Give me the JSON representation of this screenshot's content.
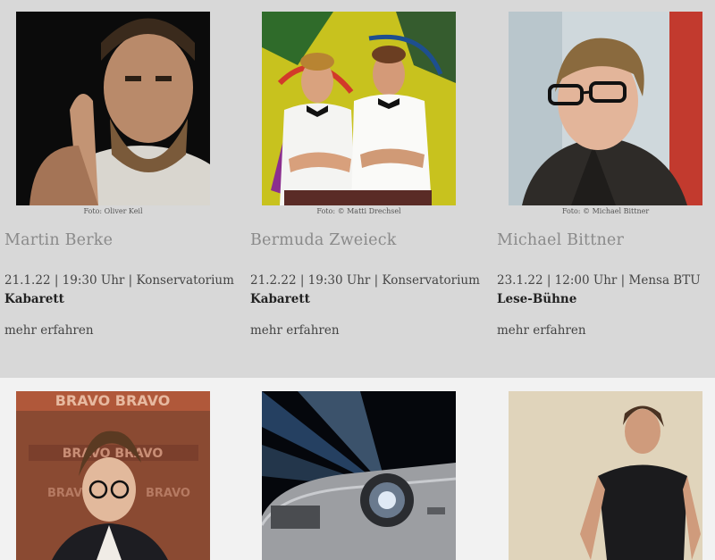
{
  "events": [
    {
      "name": "Martin Berke",
      "credit": "Foto: Oliver Keil",
      "date": "21.1.22 | 19:30 Uhr | Konservatorium",
      "category": "Kabarett",
      "link": "mehr erfahren"
    },
    {
      "name": "Bermuda Zweieck",
      "credit": "Foto: © Matti Drechsel",
      "date": "21.2.22 | 19:30 Uhr | Konservatorium",
      "category": "Kabarett",
      "link": "mehr erfahren"
    },
    {
      "name": "Michael Bittner",
      "credit": "Foto: © Michael Bittner",
      "date": "23.1.22 | 12:00 Uhr | Mensa BTU",
      "category": "Lese-Bühne",
      "link": "mehr erfahren"
    }
  ],
  "row2": {
    "poster_text": "BRAVO BRAVO",
    "poster_text_2": "BRAVO BRAVO",
    "poster_text_3": "BRAVO",
    "poster_text_4": "BRAVO"
  },
  "colors": {
    "row1_bg": "#d8d8d8",
    "row2_bg": "#f2f2f2",
    "name": "#8a8a8a"
  }
}
